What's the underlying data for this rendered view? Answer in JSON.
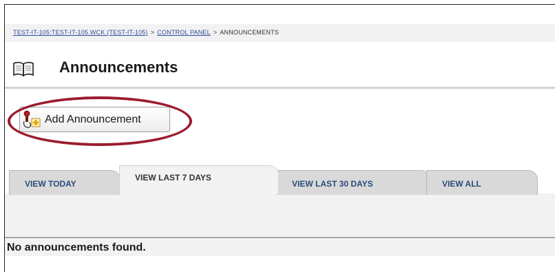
{
  "breadcrumb": {
    "course_link": "TEST-IT-105:TEST-IT-105.WCK (TEST-IT-105)",
    "separator_1": ">",
    "control_panel_link": "CONTROL PANEL",
    "separator_2": ">",
    "current": "ANNOUNCEMENTS"
  },
  "header": {
    "icon": "book-icon",
    "title": "Announcements"
  },
  "toolbar": {
    "add_label": "Add Announcement",
    "add_icon": "add-announcement-icon"
  },
  "tabs": [
    {
      "label": "VIEW TODAY",
      "active": false
    },
    {
      "label": "VIEW LAST 7 DAYS",
      "active": true
    },
    {
      "label": "VIEW LAST 30 DAYS",
      "active": false
    },
    {
      "label": "VIEW ALL",
      "active": false
    }
  ],
  "results": {
    "message": "No announcements found."
  },
  "colors": {
    "highlight": "#9b1c2e",
    "link": "#2a4a9a",
    "tab_inactive": "#d9d9d9",
    "panel": "#f2f2f2"
  }
}
